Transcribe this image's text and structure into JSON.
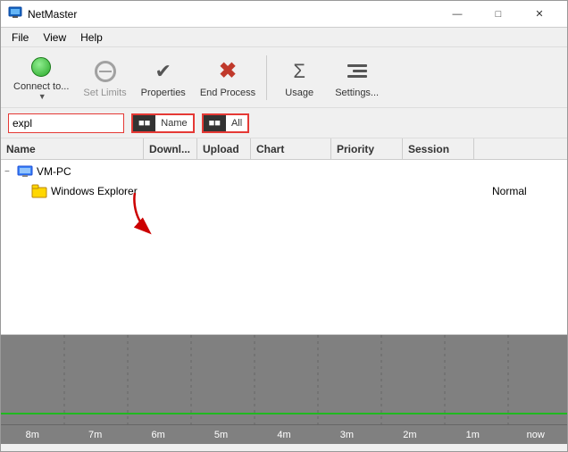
{
  "window": {
    "title": "NetMaster",
    "controls": {
      "minimize": "—",
      "maximize": "□",
      "close": "✕"
    }
  },
  "menu": {
    "items": [
      "File",
      "View",
      "Help"
    ]
  },
  "toolbar": {
    "buttons": [
      {
        "id": "connect",
        "label": "Connect to...",
        "has_dropdown": true
      },
      {
        "id": "set-limits",
        "label": "Set Limits",
        "disabled": true
      },
      {
        "id": "properties",
        "label": "Properties",
        "disabled": false
      },
      {
        "id": "end-process",
        "label": "End Process",
        "disabled": false
      },
      {
        "id": "usage",
        "label": "Usage",
        "disabled": false
      },
      {
        "id": "settings",
        "label": "Settings...",
        "disabled": false
      }
    ]
  },
  "filter": {
    "search_value": "expl",
    "search_placeholder": "",
    "name_toggle": {
      "left": "■■",
      "right": "Name"
    },
    "all_toggle": {
      "left": "■■",
      "right": "All"
    }
  },
  "table": {
    "columns": [
      "Name",
      "Downl...",
      "Upload",
      "Chart",
      "Priority",
      "Session"
    ],
    "tree": [
      {
        "id": "vm-pc",
        "indent": 0,
        "toggle": "−",
        "label": "VM-PC",
        "type": "computer",
        "priority": "",
        "session": "",
        "download": "",
        "upload": ""
      },
      {
        "id": "windows-explorer",
        "indent": 1,
        "toggle": "",
        "label": "Windows Explorer",
        "type": "app",
        "priority": "Normal",
        "session": "",
        "download": "",
        "upload": ""
      }
    ]
  },
  "chart": {
    "time_labels": [
      "8m",
      "7m",
      "6m",
      "5m",
      "4m",
      "3m",
      "2m",
      "1m",
      "now"
    ],
    "line_color": "#00ff00",
    "bg_color": "#808080"
  }
}
